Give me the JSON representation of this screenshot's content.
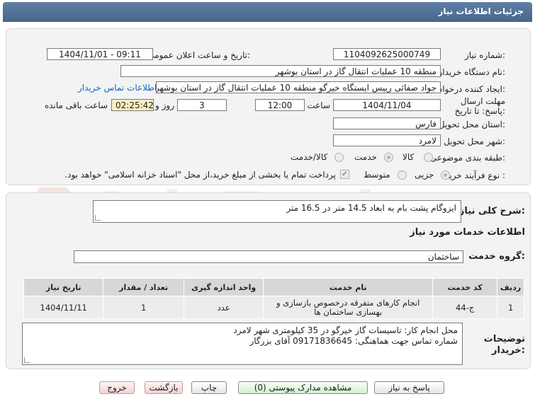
{
  "header": {
    "title": "جزئیات اطلاعات نیاز"
  },
  "form": {
    "need_number_label": "شماره نیاز:",
    "need_number": "1104092625000749",
    "announce_label": "تاریخ و ساعت اعلان عمومی:",
    "announce_value": "1404/11/01 - 09:11",
    "buyer_org_label": "نام دستگاه خریدار:",
    "buyer_org": "منطقه 10 عملیات انتقال گاز در استان بوشهر",
    "creator_label": "ایجاد کننده درخواست:",
    "creator": "جواد صفائی رییس ایستگاه خیرگو منطقه 10 عملیات انتقال گاز در استان بوشهر",
    "contact_link": "اطلاعات تماس خریدار",
    "deadline_label": "مهلت ارسال پاسخ: تا تاریخ:",
    "deadline_date": "1404/11/04",
    "time_label": "ساعت",
    "deadline_time": "12:00",
    "days_value": "3",
    "days_label": "روز و",
    "remaining_time": "02:25:42",
    "remaining_label": "ساعت باقی مانده",
    "province_label": "استان محل تحویل:",
    "province": "فارس",
    "city_label": "شهر محل تحویل:",
    "city": "لامرد",
    "category_label": "طبقه بندی موضوعی:",
    "category_options": [
      "کالا",
      "خدمت",
      "کالا/خدمت"
    ],
    "category_selected": "خدمت",
    "process_label": "نوع فرآیند خرید :",
    "process_options": [
      "جزیی",
      "متوسط"
    ],
    "process_selected": "جزیی",
    "payment_text": "پرداخت تمام یا بخشی از مبلغ خرید،از محل \"اسناد خزانه اسلامی\" خواهد بود."
  },
  "details": {
    "summary_label": "شرح کلی نیاز:",
    "summary": "ایزوگام پشت بام به ابعاد 14.5 متر در 16.5 متر",
    "services_heading": "اطلاعات خدمات مورد نیاز",
    "service_group_label": "گروه خدمت:",
    "service_group": "ساختمان",
    "table": {
      "headers": [
        "ردیف",
        "کد خدمت",
        "نام خدمت",
        "واحد اندازه گیری",
        "تعداد / مقدار",
        "تاریخ نیاز"
      ],
      "rows": [
        [
          "1",
          "ج-44",
          "انجام کارهای متفرقه درخصوص بازسازی و بهسازی ساختمان ها",
          "عدد",
          "1",
          "1404/11/11"
        ]
      ]
    },
    "buyer_notes_label": "توضیحات خریدار:",
    "buyer_notes": [
      "محل انجام کار: تاسیسات گاز خیرگو در 35 کیلومتری شهر لامرد",
      "شماره تماس جهت هماهنگی: 09171836645 آقای بزرگار"
    ]
  },
  "buttons": {
    "reply": "پاسخ به نیاز",
    "attachments": "مشاهده مدارک پیوستی (0)",
    "print": "چاپ",
    "back": "بازگشت",
    "exit": "خروج"
  },
  "watermark": {
    "text": "AriaTender.net"
  },
  "colors": {
    "header": "#4f6f98",
    "timer": "#fbf1c2",
    "link": "#1565c0",
    "exit_button": "#f3d3d3"
  }
}
